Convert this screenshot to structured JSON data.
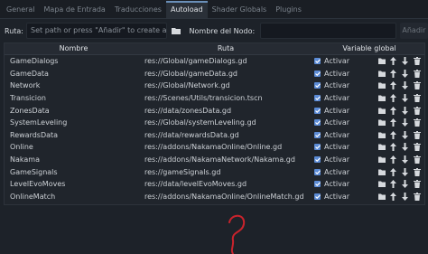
{
  "tabs": [
    "General",
    "Mapa de Entrada",
    "Traducciones",
    "Autoload",
    "Shader Globals",
    "Plugins"
  ],
  "active_tab": 3,
  "toolbar": {
    "path_label": "Ruta:",
    "path_placeholder": "Set path or press \"Añadir\" to create a script",
    "node_label": "Nombre del Nodo:",
    "node_value": "",
    "add_label": "Añadir"
  },
  "table": {
    "headers": {
      "name": "Nombre",
      "path": "Ruta",
      "global": "Variable global"
    },
    "toggle_label": "Activar",
    "rows": [
      {
        "name": "GameDialogs",
        "path": "res://Global/gameDialogs.gd",
        "enabled": true
      },
      {
        "name": "GameData",
        "path": "res://Global/gameData.gd",
        "enabled": true
      },
      {
        "name": "Network",
        "path": "res://Global/Network.gd",
        "enabled": true
      },
      {
        "name": "Transicion",
        "path": "res://Scenes/Utils/transicion.tscn",
        "enabled": true
      },
      {
        "name": "ZonesData",
        "path": "res://data/zonesData.gd",
        "enabled": true
      },
      {
        "name": "SystemLeveling",
        "path": "res://Global/systemLeveling.gd",
        "enabled": true
      },
      {
        "name": "RewardsData",
        "path": "res://data/rewardsData.gd",
        "enabled": true
      },
      {
        "name": "Online",
        "path": "res://addons/NakamaOnline/Online.gd",
        "enabled": true
      },
      {
        "name": "Nakama",
        "path": "res://addons/NakamaNetwork/Nakama.gd",
        "enabled": true
      },
      {
        "name": "GameSignals",
        "path": "res://gameSignals.gd",
        "enabled": true
      },
      {
        "name": "LevelEvoMoves",
        "path": "res://data/levelEvoMoves.gd",
        "enabled": true
      },
      {
        "name": "OnlineMatch",
        "path": "res://addons/NakamaOnline/OnlineMatch.gd",
        "enabled": true
      }
    ]
  },
  "colors": {
    "accent": "#5b8bd6",
    "annotation": "#c8232c"
  },
  "icons": {
    "row_actions": [
      "folder-icon",
      "arrow-up-icon",
      "arrow-down-icon",
      "trash-icon"
    ]
  }
}
